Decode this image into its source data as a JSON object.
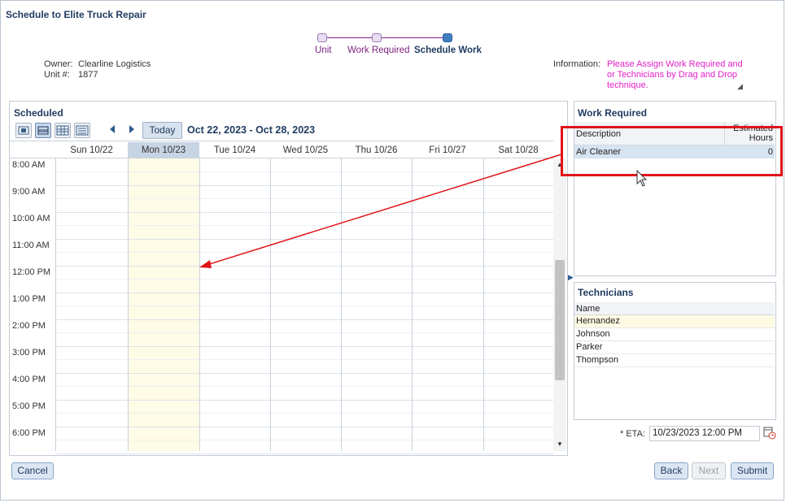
{
  "dialog": {
    "title": "Schedule to Elite Truck Repair"
  },
  "train": {
    "steps": [
      {
        "label": "Unit",
        "state": "visited"
      },
      {
        "label": "Work Required",
        "state": "visited"
      },
      {
        "label": "Schedule Work",
        "state": "current"
      }
    ]
  },
  "unit_info": {
    "owner_label": "Owner:",
    "owner_value": "Clearline Logistics",
    "unit_label": "Unit #:",
    "unit_value": "1877"
  },
  "information": {
    "label": "Information:",
    "text": "Please Assign Work Required and or Technicians by Drag and Drop technique."
  },
  "scheduled": {
    "title": "Scheduled",
    "today_label": "Today",
    "date_range": "Oct 22, 2023 - Oct 28, 2023",
    "days": [
      "Sun 10/22",
      "Mon 10/23",
      "Tue 10/24",
      "Wed 10/25",
      "Thu 10/26",
      "Fri 10/27",
      "Sat 10/28"
    ],
    "today_day": "Mon 10/23",
    "times": [
      "8:00 AM",
      "9:00 AM",
      "10:00 AM",
      "11:00 AM",
      "12:00 PM",
      "1:00 PM",
      "2:00 PM",
      "3:00 PM",
      "4:00 PM",
      "5:00 PM",
      "6:00 PM"
    ]
  },
  "work_required": {
    "title": "Work Required",
    "col_description": "Description",
    "col_hours": "Estimated Hours",
    "rows": [
      {
        "description": "Air Cleaner",
        "hours": "0"
      }
    ]
  },
  "technicians": {
    "title": "Technicians",
    "col_name": "Name",
    "rows": [
      "Hernandez",
      "Johnson",
      "Parker",
      "Thompson"
    ]
  },
  "eta": {
    "label": "* ETA:",
    "value": "10/23/2023 12:00 PM"
  },
  "buttons": {
    "cancel": "Cancel",
    "back": "Back",
    "next": "Next",
    "submit": "Submit"
  },
  "colors": {
    "annotation_red": "#e0141a",
    "info_text": "#e020c8",
    "accent": "#1f3a5f"
  }
}
